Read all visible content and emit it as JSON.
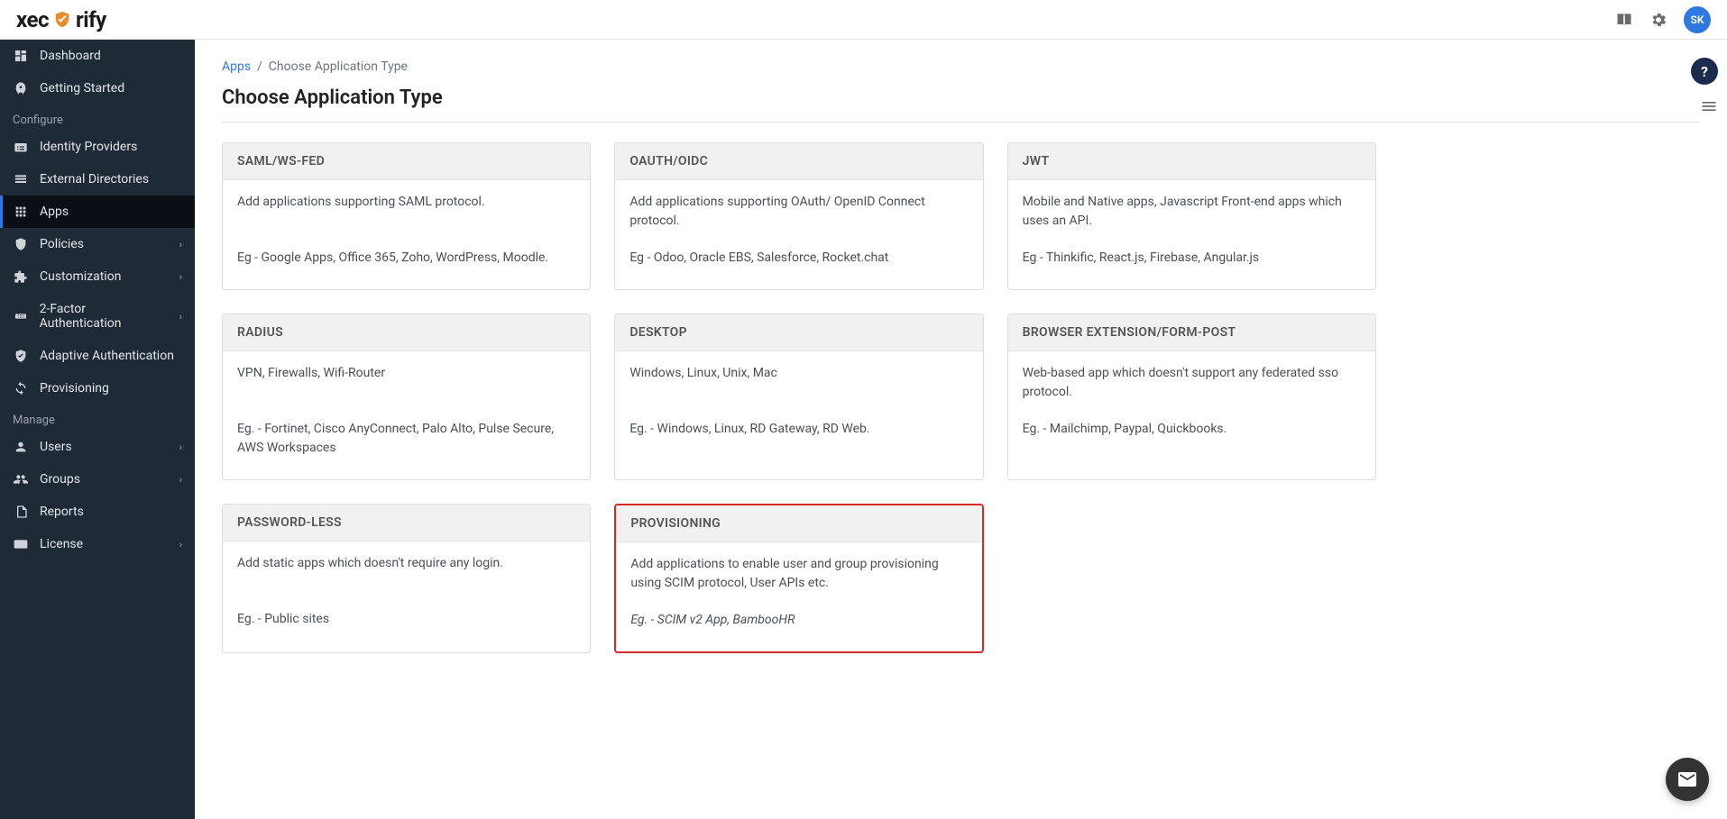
{
  "brand": {
    "name_pre": "xec",
    "name_post": "rify"
  },
  "user": {
    "initials": "SK"
  },
  "sidebar": {
    "items_top": [
      {
        "label": "Dashboard",
        "icon": "dashboard-icon"
      },
      {
        "label": "Getting Started",
        "icon": "rocket-icon"
      }
    ],
    "section_configure": "Configure",
    "items_configure": [
      {
        "label": "Identity Providers",
        "icon": "id-icon",
        "chev": false
      },
      {
        "label": "External Directories",
        "icon": "list-icon",
        "chev": false
      },
      {
        "label": "Apps",
        "icon": "apps-icon",
        "chev": false,
        "active": true
      },
      {
        "label": "Policies",
        "icon": "shield-icon",
        "chev": true
      },
      {
        "label": "Customization",
        "icon": "puzzle-icon",
        "chev": true
      },
      {
        "label": "2-Factor Authentication",
        "icon": "pin-icon",
        "chev": true
      },
      {
        "label": "Adaptive Authentication",
        "icon": "check-shield-icon",
        "chev": false
      },
      {
        "label": "Provisioning",
        "icon": "sync-icon",
        "chev": false
      }
    ],
    "section_manage": "Manage",
    "items_manage": [
      {
        "label": "Users",
        "icon": "user-icon",
        "chev": true
      },
      {
        "label": "Groups",
        "icon": "group-icon",
        "chev": true
      },
      {
        "label": "Reports",
        "icon": "clipboard-icon",
        "chev": false
      },
      {
        "label": "License",
        "icon": "card-icon",
        "chev": true
      }
    ]
  },
  "breadcrumb": {
    "root": "Apps",
    "sep": "/",
    "current": "Choose Application Type"
  },
  "page": {
    "title": "Choose Application Type"
  },
  "cards": [
    {
      "title": "SAML/WS-FED",
      "desc": "Add applications supporting SAML protocol.",
      "eg": "Eg - Google Apps, Office 365, Zoho, WordPress, Moodle."
    },
    {
      "title": "OAUTH/OIDC",
      "desc": "Add applications supporting OAuth/ OpenID Connect protocol.",
      "eg": "Eg - Odoo, Oracle EBS, Salesforce, Rocket.chat"
    },
    {
      "title": "JWT",
      "desc": "Mobile and Native apps, Javascript Front-end apps which uses an API.",
      "eg": "Eg - Thinkific, React.js, Firebase, Angular.js"
    },
    {
      "title": "RADIUS",
      "desc": "VPN, Firewalls, Wifi-Router",
      "eg": "Eg. - Fortinet, Cisco AnyConnect, Palo Alto, Pulse Secure, AWS Workspaces"
    },
    {
      "title": "DESKTOP",
      "desc": "Windows, Linux, Unix, Mac",
      "eg": "Eg. - Windows, Linux, RD Gateway, RD Web."
    },
    {
      "title": "BROWSER EXTENSION/FORM-POST",
      "desc": "Web-based app which doesn't support any federated sso protocol.",
      "eg": "Eg. - Mailchimp, Paypal, Quickbooks."
    },
    {
      "title": "PASSWORD-LESS",
      "desc": "Add static apps which doesn't require any login.",
      "eg": "Eg. - Public sites"
    },
    {
      "title": "PROVISIONING",
      "desc": "Add applications to enable user and group provisioning using SCIM protocol, User APIs etc.",
      "eg": "Eg. - SCIM v2 App, BambooHR",
      "highlight": true
    }
  ],
  "floats": {
    "help": "?"
  }
}
